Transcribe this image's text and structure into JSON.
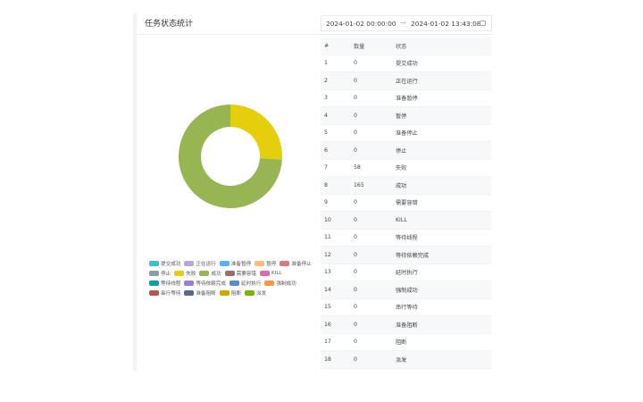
{
  "header": {
    "title": "任务状态统计",
    "range_start": "2024-01-02 00:00:00",
    "range_sep": "→",
    "range_end": "2024-01-02 13:43:08"
  },
  "table": {
    "headers": [
      "#",
      "数量",
      "状态"
    ],
    "rows": [
      {
        "idx": "1",
        "count": "0",
        "status": "提交成功"
      },
      {
        "idx": "2",
        "count": "0",
        "status": "正在运行"
      },
      {
        "idx": "3",
        "count": "0",
        "status": "准备暂停"
      },
      {
        "idx": "4",
        "count": "0",
        "status": "暂停"
      },
      {
        "idx": "5",
        "count": "0",
        "status": "准备停止"
      },
      {
        "idx": "6",
        "count": "0",
        "status": "停止"
      },
      {
        "idx": "7",
        "count": "58",
        "status": "失败"
      },
      {
        "idx": "8",
        "count": "165",
        "status": "成功"
      },
      {
        "idx": "9",
        "count": "0",
        "status": "需要容错"
      },
      {
        "idx": "10",
        "count": "0",
        "status": "KILL"
      },
      {
        "idx": "11",
        "count": "0",
        "status": "等待线程"
      },
      {
        "idx": "12",
        "count": "0",
        "status": "等待依赖完成"
      },
      {
        "idx": "13",
        "count": "0",
        "status": "延时执行"
      },
      {
        "idx": "14",
        "count": "0",
        "status": "强制成功"
      },
      {
        "idx": "15",
        "count": "0",
        "status": "串行等待"
      },
      {
        "idx": "16",
        "count": "0",
        "status": "准备阻断"
      },
      {
        "idx": "17",
        "count": "0",
        "status": "阻断"
      },
      {
        "idx": "18",
        "count": "0",
        "status": "派发"
      }
    ]
  },
  "legend": [
    {
      "label": "提交成功",
      "color": "#36c2cf"
    },
    {
      "label": "正在运行",
      "color": "#b9a5d8"
    },
    {
      "label": "准备暂停",
      "color": "#5ab1ef"
    },
    {
      "label": "暂停",
      "color": "#ffb980"
    },
    {
      "label": "准备停止",
      "color": "#d87a80"
    },
    {
      "label": "停止",
      "color": "#8d98b3"
    },
    {
      "label": "失败",
      "color": "#e5cf0d"
    },
    {
      "label": "成功",
      "color": "#97b552"
    },
    {
      "label": "需要容错",
      "color": "#95706d"
    },
    {
      "label": "KILL",
      "color": "#dc69aa"
    },
    {
      "label": "等待线程",
      "color": "#07a2a4"
    },
    {
      "label": "等待依赖完成",
      "color": "#9a7fd1"
    },
    {
      "label": "延时执行",
      "color": "#588dd5"
    },
    {
      "label": "强制成功",
      "color": "#f5994e"
    },
    {
      "label": "串行等待",
      "color": "#c05050"
    },
    {
      "label": "准备阻断",
      "color": "#59678c"
    },
    {
      "label": "阻断",
      "color": "#c9ab00"
    },
    {
      "label": "派发",
      "color": "#7eb00a"
    }
  ],
  "chart_data": {
    "type": "pie",
    "donut": true,
    "slices": [
      {
        "label": "失败",
        "value": 58,
        "color": "#e5cf0d"
      },
      {
        "label": "成功",
        "value": 165,
        "color": "#97b552"
      }
    ]
  }
}
